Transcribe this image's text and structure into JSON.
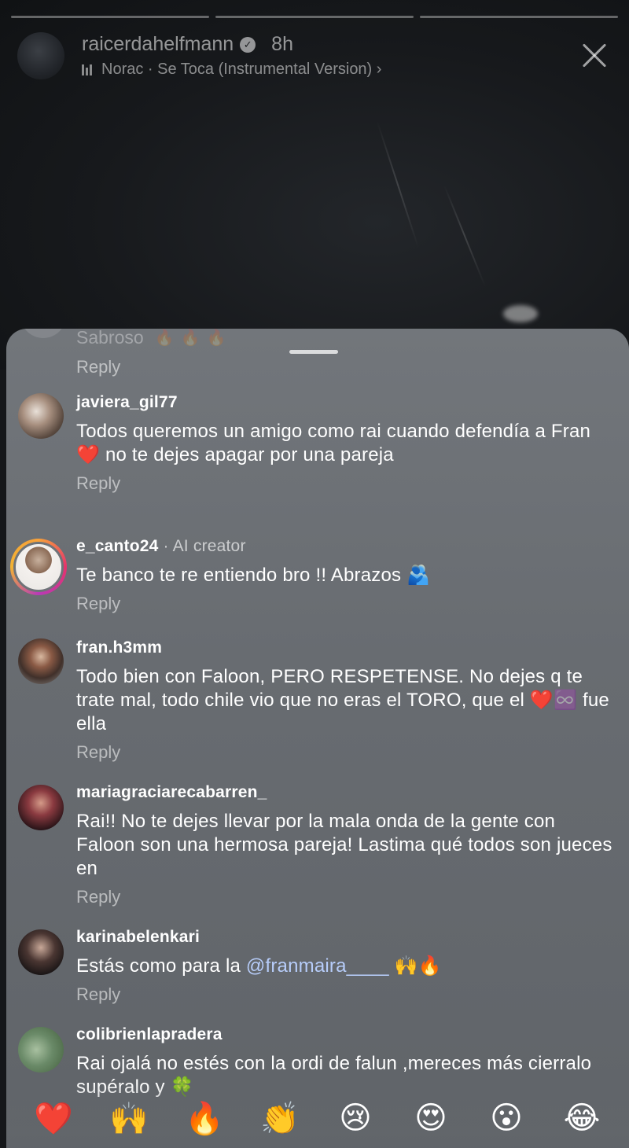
{
  "story": {
    "username": "raicerdahelfmann",
    "time": "8h",
    "music": "Norac · Se Toca (Instrumental Version) ›"
  },
  "sheet": {
    "faded_comment": "Sabroso",
    "faded_emojis": "🔥🔥🔥",
    "reply_label": "Reply"
  },
  "comments": [
    {
      "username": "javiera_gil77",
      "text_parts": [
        "Todos queremos un amigo como rai cuando defendía a Fran ",
        "❤️",
        " no te dejes apagar por una pareja"
      ],
      "reply": "Reply"
    },
    {
      "username": "e_canto24",
      "badge": "· AI creator",
      "text_parts": [
        "Te banco te re entiendo bro !! Abrazos ",
        "🫂"
      ],
      "reply": "Reply"
    },
    {
      "username": "fran.h3mm",
      "text_parts": [
        "Todo bien con Faloon, PERO RESPETENSE. No dejes q te trate mal, todo chile vio que no eras el TORO, que el ",
        "❤️",
        "♾️",
        " fue ella"
      ],
      "reply": "Reply"
    },
    {
      "username": "mariagraciarecabarren_",
      "text": "Rai!! No te dejes llevar por la mala onda de la gente con Faloon son una hermosa pareja! Lastima qué todos son jueces en",
      "reply": "Reply"
    },
    {
      "username": "karinabelenkari",
      "text_before": "Estás como para la ",
      "mention": "@franmaira____",
      "emojis": " 🙌🔥",
      "reply": "Reply"
    },
    {
      "username": "colibrienlapradera",
      "text": "Rai ojalá no estés con la ordi de falun ,mereces más cierralo supéralo y 🍀"
    }
  ],
  "reactions": [
    "❤️",
    "🙌",
    "🔥",
    "👏",
    "😢",
    "😍",
    "😮",
    "😂"
  ]
}
